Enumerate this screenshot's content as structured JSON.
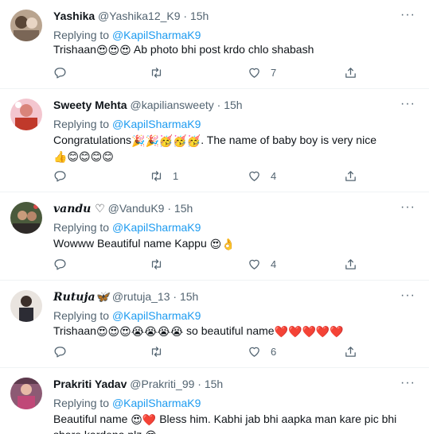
{
  "reply_prefix": "Replying to",
  "colors": {
    "text": "#0f1419",
    "secondary": "#536471",
    "link": "#1d9bf0",
    "divider": "#eff3f4"
  },
  "icons": {
    "reply": "comment-icon",
    "retweet": "retweet-icon",
    "like": "heart-icon",
    "share": "share-icon",
    "more": "more-icon"
  },
  "tweets": [
    {
      "display_name": "Yashika",
      "handle": "@Yashika12_K9",
      "separator": "·",
      "time": "15h",
      "replying_to": "@KapilSharmaK9",
      "text_parts": [
        "Trishaan",
        "😍😍😍",
        " Ab photo bhi post krdo chlo shabash"
      ],
      "replies": "",
      "retweets": "",
      "likes": "7"
    },
    {
      "display_name": "Sweety Mehta",
      "handle": "@kapiliansweety",
      "separator": "·",
      "time": "15h",
      "replying_to": "@KapilSharmaK9",
      "text_parts": [
        "Congratulations",
        "🎉🎉🥳🥳🥳",
        ". The name of baby boy is very nice ",
        "👍😊😊😊😊"
      ],
      "replies": "",
      "retweets": "1",
      "likes": "4"
    },
    {
      "display_name": "vandu ♡",
      "handle": "@VanduK9",
      "separator": "·",
      "time": "15h",
      "replying_to": "@KapilSharmaK9",
      "text_parts": [
        "Wowww Beautiful name Kappu ",
        "😍👌"
      ],
      "replies": "",
      "retweets": "",
      "likes": "4"
    },
    {
      "display_name": "Rutuja🦋",
      "handle": "@rutuja_13",
      "separator": "·",
      "time": "15h",
      "replying_to": "@KapilSharmaK9",
      "text_parts": [
        "Trishaan",
        "😍😍😍😭😭😭😭",
        " so beautiful name",
        "❤️❤️❤️❤️❤️"
      ],
      "replies": "",
      "retweets": "",
      "likes": "6"
    },
    {
      "display_name": "Prakriti Yadav",
      "handle": "@Prakriti_99",
      "separator": "·",
      "time": "15h",
      "replying_to": "@KapilSharmaK9",
      "text_parts": [
        "Beautiful name ",
        "😍❤️",
        " Bless him. Kabhi jab bhi aapka man kare pic bhi share kardena plz ",
        "😍"
      ],
      "replies": "",
      "retweets": "",
      "likes": ""
    }
  ]
}
